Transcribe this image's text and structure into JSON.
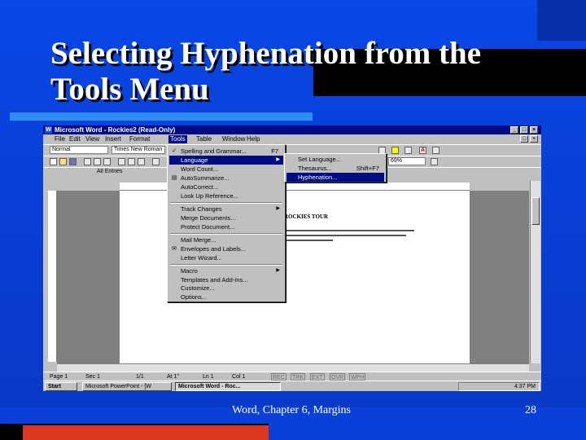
{
  "slide": {
    "title": "Selecting Hyphenation from the Tools Menu",
    "footer_center": "Word, Chapter 6, Margins",
    "page_number": "28",
    "colors": {
      "background": "#0a3fd9",
      "accent_bar": "#2f8df2",
      "red_bar": "#d9381e"
    }
  },
  "word_window": {
    "title": "Microsoft Word - Rockies2 (Read-Only)",
    "menu": [
      "File",
      "Edit",
      "View",
      "Insert",
      "Format",
      "Tools",
      "Table",
      "Window",
      "Help"
    ],
    "style_value": "Normal",
    "font_value": "Times New Roman",
    "zoom_value": "69%",
    "autotext_label": "All Entries",
    "doc_heading": "ROCKIES TOUR",
    "tools_menu": [
      {
        "label": "Spelling and Grammar...",
        "shortcut": "F7",
        "icon": "spell-check-icon"
      },
      {
        "label": "Language",
        "submenu": true,
        "highlighted": true
      },
      {
        "label": "Word Count..."
      },
      {
        "label": "AutoSummarize...",
        "icon": "autosummarize-icon"
      },
      {
        "label": "AutoCorrect..."
      },
      {
        "label": "Look Up Reference..."
      },
      {
        "label": "Track Changes",
        "submenu": true
      },
      {
        "label": "Merge Documents..."
      },
      {
        "label": "Protect Document..."
      },
      {
        "label": "Mail Merge..."
      },
      {
        "label": "Envelopes and Labels...",
        "icon": "envelope-icon"
      },
      {
        "label": "Letter Wizard..."
      },
      {
        "label": "Macro",
        "submenu": true
      },
      {
        "label": "Templates and Add-Ins..."
      },
      {
        "label": "Customize..."
      },
      {
        "label": "Options..."
      }
    ],
    "language_submenu": [
      {
        "label": "Set Language..."
      },
      {
        "label": "Thesaurus...",
        "shortcut": "Shift+F7"
      },
      {
        "label": "Hyphenation...",
        "highlighted": true
      }
    ],
    "status": {
      "page": "Page 1",
      "sec": "Sec 1",
      "pages": "1/1",
      "at": "At 1\"",
      "ln": "Ln 1",
      "col": "Col 1",
      "indicators": [
        "REC",
        "TRK",
        "EXT",
        "OVR",
        "WPH"
      ]
    },
    "taskbar": {
      "start": "Start",
      "buttons": [
        "Microsoft PowerPoint - [W",
        "Microsoft Word - Roc..."
      ],
      "clock": "4:37 PM"
    }
  }
}
